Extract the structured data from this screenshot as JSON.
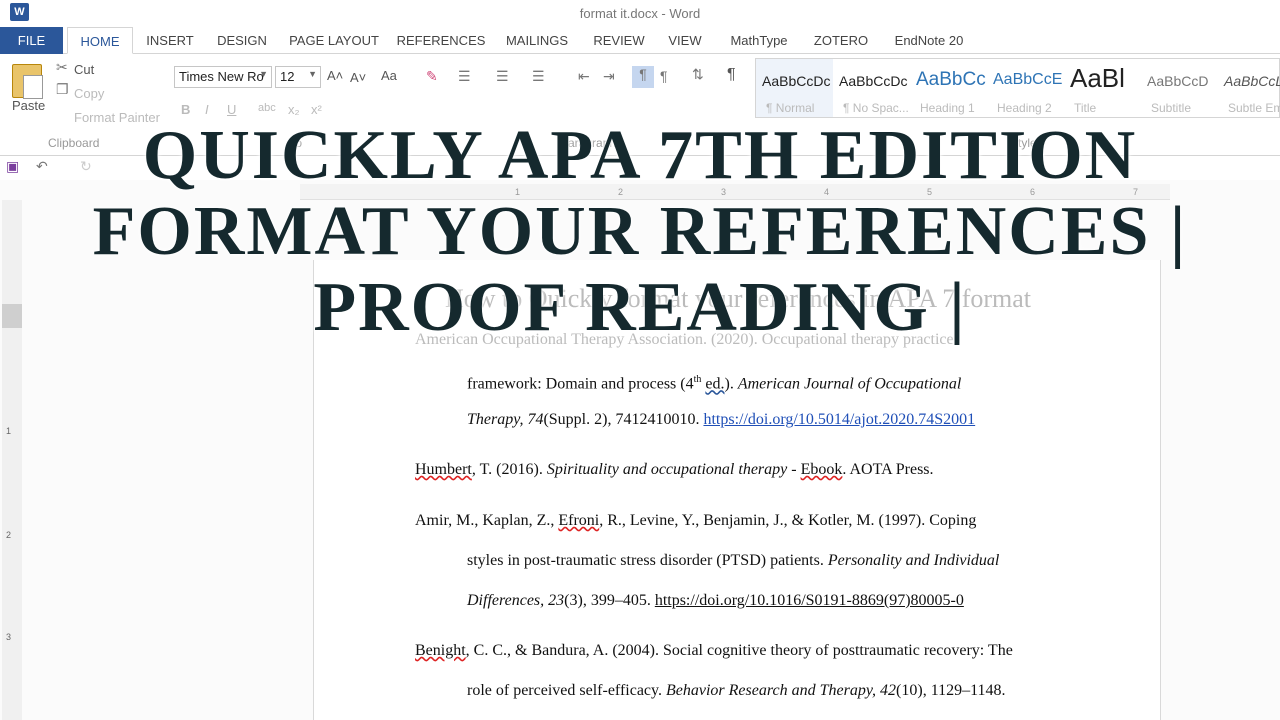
{
  "window": {
    "title": "format it.docx - Word",
    "app_logo": "W"
  },
  "tabs": [
    "FILE",
    "HOME",
    "INSERT",
    "DESIGN",
    "PAGE LAYOUT",
    "REFERENCES",
    "MAILINGS",
    "REVIEW",
    "VIEW",
    "MathType",
    "ZOTERO",
    "EndNote 20"
  ],
  "ribbon": {
    "clipboard": {
      "paste": "Paste",
      "cut": "Cut",
      "copy": "Copy",
      "format_painter": "Format Painter",
      "label": "Clipboard"
    },
    "font": {
      "name": "Times New Ro",
      "size": "12",
      "grow": "A˄",
      "shrink": "A˅",
      "case": "Aa",
      "bold": "B",
      "italic": "I",
      "underline": "U",
      "strike": "abc",
      "sub": "x₂",
      "sup": "x²",
      "label": "Fo"
    },
    "paragraph": {
      "label": "Paragraph",
      "pilcrow": "¶"
    },
    "styles": [
      {
        "preview": "AaBbCcDc",
        "name": "¶ Normal"
      },
      {
        "preview": "AaBbCcDc",
        "name": "¶ No Spac..."
      },
      {
        "preview": "AaBbCc",
        "name": "Heading 1"
      },
      {
        "preview": "AaBbCcE",
        "name": "Heading 2"
      },
      {
        "preview": "AaBl",
        "name": "Title"
      },
      {
        "preview": "AaBbCcD",
        "name": "Subtitle"
      },
      {
        "preview": "AaBbCcL",
        "name": "Subtle Em"
      }
    ],
    "styles_label": "Styles"
  },
  "ruler": {
    "marks": [
      "1",
      "2",
      "3",
      "4",
      "5",
      "6",
      "7"
    ],
    "vmarks": [
      "1",
      "2",
      "3"
    ]
  },
  "document": {
    "heading": "How to Quickly format your references in APA 7 format",
    "refs": {
      "r1a": "American Occupational Therapy Association. (2020). Occupational therapy practice",
      "r1b_pre": "framework: Domain and process (4",
      "r1b_sup": "th",
      "r1b_ed": "ed.",
      "r1b_post": "). ",
      "r1b_it": "American Journal of Occupational",
      "r1c_it": "Therapy, 74",
      "r1c_post": "(Suppl. 2), 7412410010. ",
      "r1c_link": "https://doi.org/10.5014/ajot.2020.74S2001",
      "r2_name": "Humbert",
      "r2_pre": ", T. (2016). ",
      "r2_it": "Spirituality and occupational therapy",
      "r2_mid": " - ",
      "r2_ebook": "Ebook",
      "r2_post": ". AOTA Press.",
      "r3a_pre": "Amir, M., Kaplan, Z., ",
      "r3a_name": "Efroni",
      "r3a_post": ", R., Levine, Y., Benjamin, J., & Kotler, M. (1997). Coping",
      "r3b_pre": "styles in post-traumatic stress disorder (PTSD) patients. ",
      "r3b_it": "Personality and Individual",
      "r3c_it": "Differences, 23",
      "r3c_post": "(3), 399–405. ",
      "r3c_link": "https://doi.org/10.1016/S0191-8869(97)80005-0",
      "r4a_name": "Benight",
      "r4a_post": ", C. C., & Bandura, A. (2004). Social cognitive theory of posttraumatic recovery: The",
      "r4b_pre": "role of perceived self-efficacy. ",
      "r4b_it": "Behavior Research and Therapy",
      "r4b_it2": ", 42",
      "r4b_post": "(10), 1129–1148."
    }
  },
  "overlay": {
    "line1": "QUICKLY APA 7TH EDITION",
    "line2": "FORMAT YOUR REFERENCES |",
    "line3": "PROOF READING |"
  }
}
